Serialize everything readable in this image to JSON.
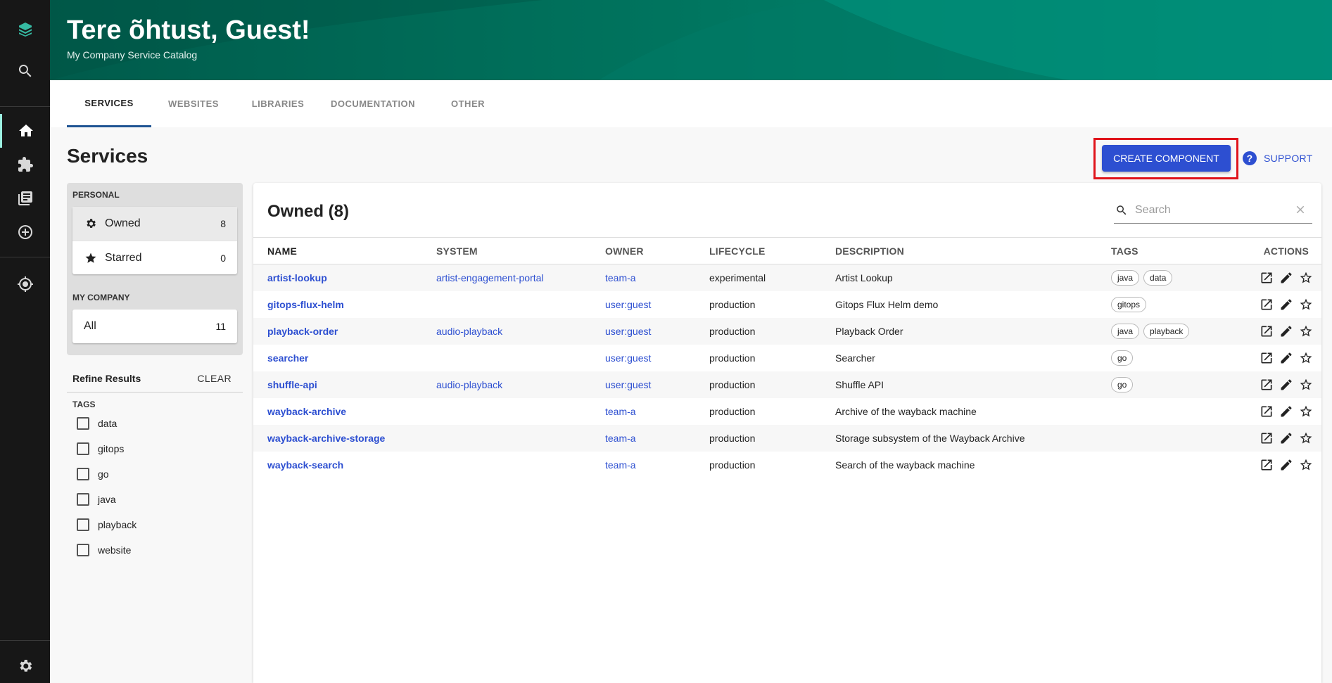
{
  "header": {
    "title": "Tere õhtust, Guest!",
    "subtitle": "My Company Service Catalog"
  },
  "tabs": [
    {
      "label": "SERVICES",
      "active": true
    },
    {
      "label": "WEBSITES",
      "active": false
    },
    {
      "label": "LIBRARIES",
      "active": false
    },
    {
      "label": "DOCUMENTATION",
      "active": false
    },
    {
      "label": "OTHER",
      "active": false
    }
  ],
  "page": {
    "title": "Services",
    "create_label": "CREATE COMPONENT",
    "support_label": "SUPPORT",
    "support_icon": "?"
  },
  "filters": {
    "personal_heading": "PERSONAL",
    "owned": {
      "label": "Owned",
      "count": "8"
    },
    "starred": {
      "label": "Starred",
      "count": "0"
    },
    "company_heading": "MY COMPANY",
    "all": {
      "label": "All",
      "count": "11"
    },
    "refine_title": "Refine Results",
    "clear_label": "CLEAR",
    "tags_heading": "TAGS",
    "tags": [
      "data",
      "gitops",
      "go",
      "java",
      "playback",
      "website"
    ]
  },
  "table": {
    "title": "Owned (8)",
    "search_placeholder": "Search",
    "columns": [
      "NAME",
      "SYSTEM",
      "OWNER",
      "LIFECYCLE",
      "DESCRIPTION",
      "TAGS",
      "ACTIONS"
    ],
    "rows": [
      {
        "name": "artist-lookup",
        "system": "artist-engagement-portal",
        "owner": "team-a",
        "lifecycle": "experimental",
        "description": "Artist Lookup",
        "tags": [
          "java",
          "data"
        ]
      },
      {
        "name": "gitops-flux-helm",
        "system": "",
        "owner": "user:guest",
        "lifecycle": "production",
        "description": "Gitops Flux Helm demo",
        "tags": [
          "gitops"
        ]
      },
      {
        "name": "playback-order",
        "system": "audio-playback",
        "owner": "user:guest",
        "lifecycle": "production",
        "description": "Playback Order",
        "tags": [
          "java",
          "playback"
        ]
      },
      {
        "name": "searcher",
        "system": "",
        "owner": "user:guest",
        "lifecycle": "production",
        "description": "Searcher",
        "tags": [
          "go"
        ]
      },
      {
        "name": "shuffle-api",
        "system": "audio-playback",
        "owner": "user:guest",
        "lifecycle": "production",
        "description": "Shuffle API",
        "tags": [
          "go"
        ]
      },
      {
        "name": "wayback-archive",
        "system": "",
        "owner": "team-a",
        "lifecycle": "production",
        "description": "Archive of the wayback machine",
        "tags": []
      },
      {
        "name": "wayback-archive-storage",
        "system": "",
        "owner": "team-a",
        "lifecycle": "production",
        "description": "Storage subsystem of the Wayback Archive",
        "tags": []
      },
      {
        "name": "wayback-search",
        "system": "",
        "owner": "team-a",
        "lifecycle": "production",
        "description": "Search of the wayback machine",
        "tags": []
      }
    ]
  },
  "colors": {
    "accent": "#2d4fd1",
    "header": "#00755f",
    "highlight": "#e0141b"
  }
}
